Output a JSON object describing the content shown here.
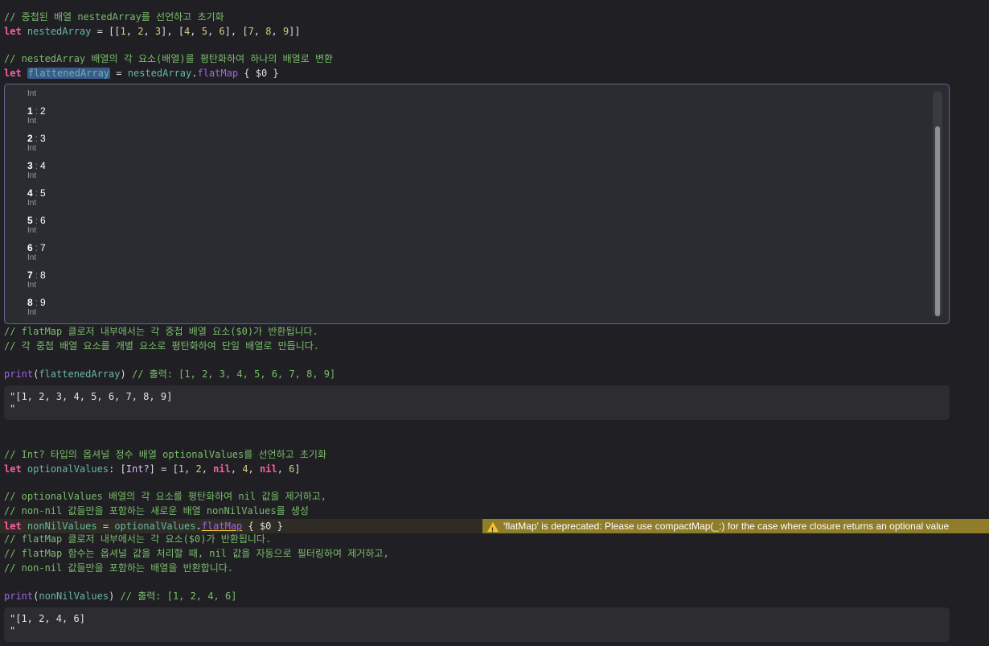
{
  "code": {
    "c1": "// 중첩된 배열 nestedArray를 선언하고 초기화",
    "l2": {
      "kw": "let",
      "name": "nestedArray",
      "eq": " = [[",
      "n1": "1",
      "s1": ", ",
      "n2": "2",
      "s2": ", ",
      "n3": "3",
      "s3": "], [",
      "n4": "4",
      "s4": ", ",
      "n5": "5",
      "s5": ", ",
      "n6": "6",
      "s6": "], [",
      "n7": "7",
      "s7": ", ",
      "n8": "8",
      "s8": ", ",
      "n9": "9",
      "end": "]]"
    },
    "c3": "// nestedArray 배열의 각 요소(배열)를 평탄화하여 하나의 배열로 변환",
    "l4": {
      "kw": "let",
      "name": "flattenedArray",
      "eq": " = ",
      "obj": "nestedArray",
      "dot": ".",
      "fn": "flatMap",
      "rest": " { $0 }"
    },
    "c5": "// flatMap 클로저 내부에서는 각 중첩 배열 요소($0)가 반환됩니다.",
    "c6": "// 각 중첩 배열 요소를 개별 요소로 평탄화하여 단일 배열로 만듭니다.",
    "l7": {
      "fn": "print",
      "open": "(",
      "arg": "flattenedArray",
      "close": ")",
      "comment": " // 출력: [1, 2, 3, 4, 5, 6, 7, 8, 9]"
    },
    "c8": "// Int? 타입의 옵셔널 정수 배열 optionalValues를 선언하고 초기화",
    "l9": {
      "kw": "let",
      "name": "optionalValues",
      "colon": ": [",
      "type": "Int?",
      "eq": "] = [",
      "n1": "1",
      "s1": ", ",
      "n2": "2",
      "s2": ", ",
      "nil1": "nil",
      "s3": ", ",
      "n4": "4",
      "s4": ", ",
      "nil2": "nil",
      "s5": ", ",
      "n6": "6",
      "end": "]"
    },
    "c10": "// optionalValues 배열의 각 요소를 평탄화하여 nil 값을 제거하고,",
    "c11": "// non-nil 값들만을 포함하는 새로운 배열 nonNilValues를 생성",
    "l12": {
      "kw": "let",
      "name": "nonNilValues",
      "eq": " = ",
      "obj": "optionalValues",
      "dot": ".",
      "fn": "flatMap",
      "rest": " { $0 }"
    },
    "c13": "// flatMap 클로저 내부에서는 각 요소($0)가 반환됩니다.",
    "c14": "// flatMap 함수는 옵셔널 값을 처리할 때, nil 값을 자동으로 필터링하여 제거하고,",
    "c15": "// non-nil 값들만을 포함하는 배열을 반환합니다.",
    "l16": {
      "fn": "print",
      "open": "(",
      "arg": "nonNilValues",
      "close": ")",
      "comment": " // 출력: [1, 2, 4, 6]"
    }
  },
  "popover": {
    "first_type": "Int",
    "items": [
      {
        "index": "1",
        "value": "2",
        "type": "Int"
      },
      {
        "index": "2",
        "value": "3",
        "type": "Int"
      },
      {
        "index": "3",
        "value": "4",
        "type": "Int"
      },
      {
        "index": "4",
        "value": "5",
        "type": "Int"
      },
      {
        "index": "5",
        "value": "6",
        "type": "Int"
      },
      {
        "index": "6",
        "value": "7",
        "type": "Int"
      },
      {
        "index": "7",
        "value": "8",
        "type": "Int"
      },
      {
        "index": "8",
        "value": "9",
        "type": "Int"
      }
    ]
  },
  "results": {
    "r1": "\"[1, 2, 3, 4, 5, 6, 7, 8, 9]\n\"",
    "r2": "\"[1, 2, 4, 6]\n\""
  },
  "warning": {
    "icon": "warning-triangle-icon",
    "message": "'flatMap' is deprecated: Please use compactMap(_:) for the case where closure returns an optional value"
  },
  "colors": {
    "comment": "#7bbc6a",
    "keyword": "#fc5fa3",
    "number": "#d9c97c",
    "identifier": "#67b7a4",
    "function": "#a167e6",
    "warning_bg": "#8f7d2a"
  }
}
